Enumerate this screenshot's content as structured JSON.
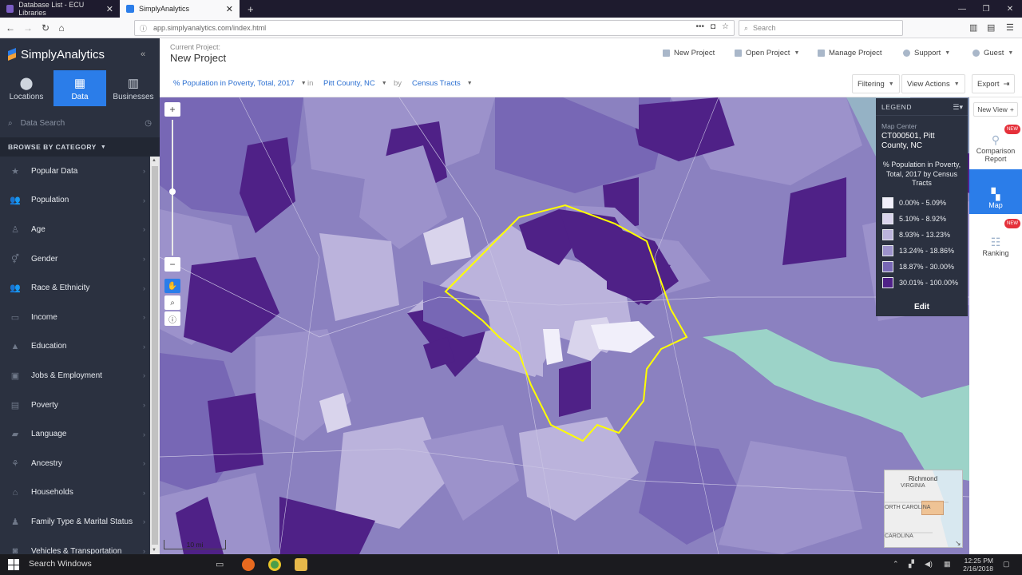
{
  "browser": {
    "tabs": [
      {
        "label": "Database List - ECU Libraries",
        "active": false
      },
      {
        "label": "SimplyAnalytics",
        "active": true
      }
    ],
    "new_tab": "+",
    "url": "app.simplyanalytics.com/index.html",
    "search_placeholder": "Search"
  },
  "app": {
    "brand": "SimplyAnalytics",
    "current_project_label": "Current Project:",
    "project_name": "New Project",
    "header_buttons": [
      {
        "label": "New Project"
      },
      {
        "label": "Open Project"
      },
      {
        "label": "Manage Project"
      },
      {
        "label": "Support"
      },
      {
        "label": "Guest"
      }
    ]
  },
  "sidebar": {
    "modes": [
      {
        "label": "Locations",
        "icon": "location-pin-icon"
      },
      {
        "label": "Data",
        "icon": "grid-icon",
        "active": true
      },
      {
        "label": "Businesses",
        "icon": "building-icon"
      }
    ],
    "search_placeholder": "Data Search",
    "browse_label": "BROWSE BY CATEGORY",
    "categories": [
      {
        "label": "Popular Data",
        "icon": "star-icon"
      },
      {
        "label": "Population",
        "icon": "people-icon"
      },
      {
        "label": "Age",
        "icon": "person-icon"
      },
      {
        "label": "Gender",
        "icon": "gender-icon"
      },
      {
        "label": "Race & Ethnicity",
        "icon": "people-icon"
      },
      {
        "label": "Income",
        "icon": "money-icon"
      },
      {
        "label": "Education",
        "icon": "graduation-cap-icon"
      },
      {
        "label": "Jobs & Employment",
        "icon": "briefcase-icon"
      },
      {
        "label": "Poverty",
        "icon": "poverty-icon"
      },
      {
        "label": "Language",
        "icon": "speech-icon"
      },
      {
        "label": "Ancestry",
        "icon": "family-tree-icon"
      },
      {
        "label": "Households",
        "icon": "house-icon"
      },
      {
        "label": "Family Type & Marital Status",
        "icon": "family-icon"
      },
      {
        "label": "Vehicles & Transportation",
        "icon": "car-icon"
      }
    ]
  },
  "toolbar": {
    "variable": "% Population in Poverty, Total, 2017",
    "in_label": "in",
    "location": "Pitt County, NC",
    "by_label": "by",
    "unit": "Census Tracts",
    "filtering": "Filtering",
    "view_actions": "View Actions",
    "export": "Export"
  },
  "legend": {
    "header": "LEGEND",
    "map_center_label": "Map Center",
    "map_center_value": "CT000501, Pitt County, NC",
    "title": "% Population in Poverty, Total, 2017 by Census Tracts",
    "ranges": [
      {
        "label": "0.00% - 5.09%",
        "color": "#f1effa"
      },
      {
        "label": "5.10% - 8.92%",
        "color": "#d9d4ec"
      },
      {
        "label": "8.93% - 13.23%",
        "color": "#bbb3dc"
      },
      {
        "label": "13.24% - 18.86%",
        "color": "#9c92cb"
      },
      {
        "label": "18.87% - 30.00%",
        "color": "#7767b5"
      },
      {
        "label": "30.01% - 100.00%",
        "color": "#4f2187"
      }
    ],
    "edit_label": "Edit"
  },
  "right_panel": {
    "new_view": "New View",
    "items": [
      {
        "label": "Comparison Report",
        "badge": "NEW",
        "icon": "comparison-icon"
      },
      {
        "label": "Map",
        "active": true,
        "icon": "map-icon"
      },
      {
        "label": "Ranking",
        "badge": "NEW",
        "icon": "ranking-icon"
      }
    ]
  },
  "map": {
    "scale_label": "10 mi",
    "minimap": {
      "labels": [
        "Richmond",
        "VIRGINIA",
        "ORTH CAROLINA",
        "CAROLINA"
      ]
    }
  },
  "taskbar": {
    "search": "Search Windows",
    "time": "12:25 PM",
    "date": "2/16/2018"
  }
}
